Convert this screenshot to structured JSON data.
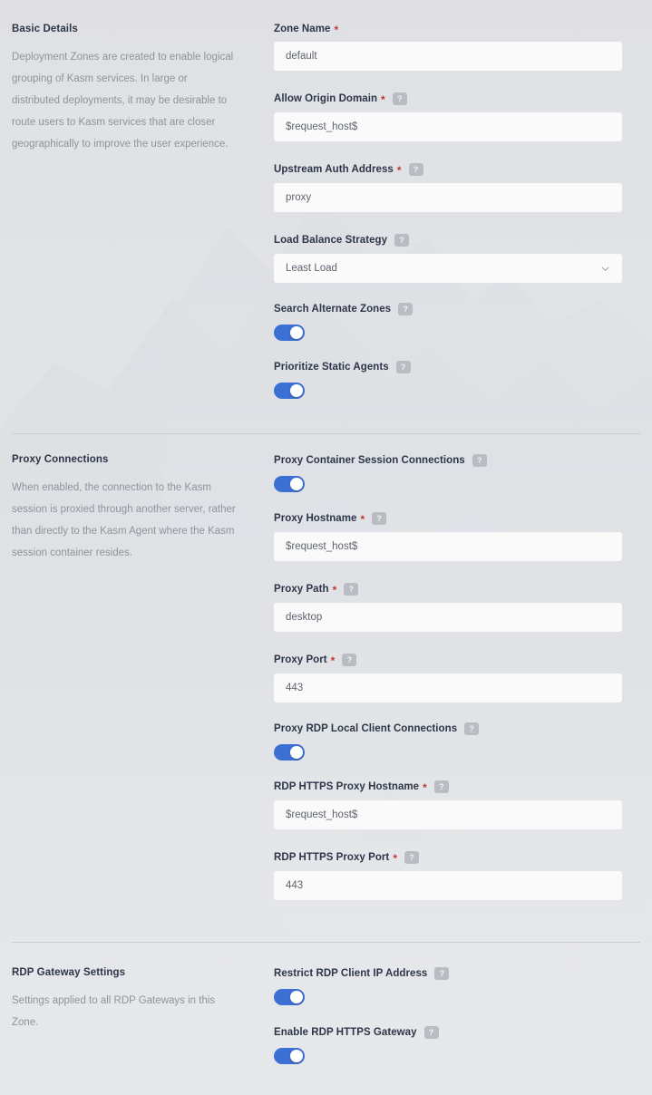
{
  "colors": {
    "accent_toggle_on": "#3d70d4",
    "required_asterisk": "#c0392b",
    "heading_text": "#2d3648",
    "muted_text": "#8f939c",
    "field_bg": "#fafafb",
    "page_bg": "#d8dade",
    "divider": "#c9cbd0",
    "help_badge_bg": "#b9bcc2"
  },
  "sections": [
    {
      "id": "basic-details",
      "title": "Basic Details",
      "description": "Deployment Zones are created to enable logical grouping of Kasm services. In large or distributed deployments, it may be desirable to route users to Kasm services that are closer geographically to improve the user experience.",
      "fields": [
        {
          "name": "zone-name",
          "label": "Zone Name",
          "required": true,
          "help": false,
          "type": "text",
          "value": "default"
        },
        {
          "name": "allow-origin-domain",
          "label": "Allow Origin Domain",
          "required": true,
          "help": true,
          "help_glyph": "?",
          "type": "text",
          "value": "$request_host$"
        },
        {
          "name": "upstream-auth-address",
          "label": "Upstream Auth Address",
          "required": true,
          "help": true,
          "help_glyph": "?",
          "type": "text",
          "value": "proxy"
        },
        {
          "name": "load-balance-strategy",
          "label": "Load Balance Strategy",
          "required": false,
          "help": true,
          "help_glyph": "?",
          "type": "select",
          "value": "Least Load",
          "icon": "chevron-down-icon"
        },
        {
          "name": "search-alternate-zones",
          "label": "Search Alternate Zones",
          "required": false,
          "help": true,
          "help_glyph": "?",
          "type": "toggle",
          "value": "on"
        },
        {
          "name": "prioritize-static-agents",
          "label": "Prioritize Static Agents",
          "required": false,
          "help": true,
          "help_glyph": "?",
          "type": "toggle",
          "value": "on"
        }
      ]
    },
    {
      "id": "proxy-connections",
      "title": "Proxy Connections",
      "description": "When enabled, the connection to the Kasm session is proxied through another server, rather than directly to the Kasm Agent where the Kasm session container resides.",
      "fields": [
        {
          "name": "proxy-container-session-connections",
          "label": "Proxy Container Session Connections",
          "required": false,
          "help": true,
          "help_glyph": "?",
          "type": "toggle",
          "value": "on"
        },
        {
          "name": "proxy-hostname",
          "label": "Proxy Hostname",
          "required": true,
          "help": true,
          "help_glyph": "?",
          "type": "text",
          "value": "$request_host$"
        },
        {
          "name": "proxy-path",
          "label": "Proxy Path",
          "required": true,
          "help": true,
          "help_glyph": "?",
          "type": "text",
          "value": "desktop"
        },
        {
          "name": "proxy-port",
          "label": "Proxy Port",
          "required": true,
          "help": true,
          "help_glyph": "?",
          "type": "text",
          "value": "443"
        },
        {
          "name": "proxy-rdp-local-client-connections",
          "label": "Proxy RDP Local Client Connections",
          "required": false,
          "help": true,
          "help_glyph": "?",
          "type": "toggle",
          "value": "on"
        },
        {
          "name": "rdp-https-proxy-hostname",
          "label": "RDP HTTPS Proxy Hostname",
          "required": true,
          "help": true,
          "help_glyph": "?",
          "type": "text",
          "value": "$request_host$"
        },
        {
          "name": "rdp-https-proxy-port",
          "label": "RDP HTTPS Proxy Port",
          "required": true,
          "help": true,
          "help_glyph": "?",
          "type": "text",
          "value": "443"
        }
      ]
    },
    {
      "id": "rdp-gateway-settings",
      "title": "RDP Gateway Settings",
      "description": "Settings applied to all RDP Gateways in this Zone.",
      "fields": [
        {
          "name": "restrict-rdp-client-ip-address",
          "label": "Restrict RDP Client IP Address",
          "required": false,
          "help": true,
          "help_glyph": "?",
          "type": "toggle",
          "value": "on"
        },
        {
          "name": "enable-rdp-https-gateway",
          "label": "Enable RDP HTTPS Gateway",
          "required": false,
          "help": true,
          "help_glyph": "?",
          "type": "toggle",
          "value": "on"
        }
      ]
    }
  ]
}
